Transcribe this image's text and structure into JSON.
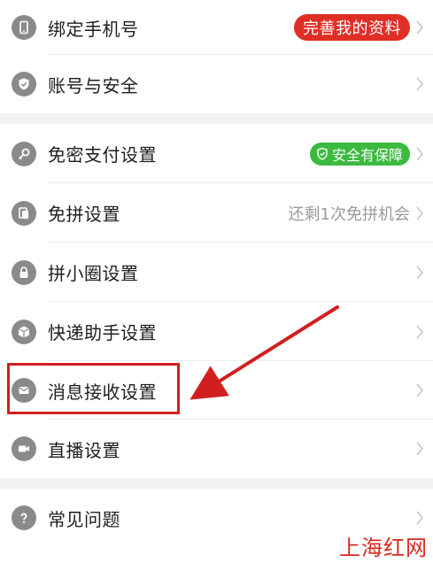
{
  "menu": {
    "bind_phone": {
      "label": "绑定手机号",
      "badge": "完善我的资料"
    },
    "account_security": {
      "label": "账号与安全"
    },
    "password_free_pay": {
      "label": "免密支付设置",
      "badge": "安全有保障"
    },
    "group_free": {
      "label": "免拼设置",
      "note": "还剩1次免拼机会"
    },
    "circle": {
      "label": "拼小圈设置"
    },
    "courier": {
      "label": "快递助手设置"
    },
    "message": {
      "label": "消息接收设置"
    },
    "live": {
      "label": "直播设置"
    },
    "faq": {
      "label": "常见问题"
    }
  },
  "watermark": "上海红网",
  "colors": {
    "accent_red": "#e02e24",
    "badge_green": "#3bba3f",
    "annotation_red": "#d11f1f",
    "icon_gray": "#8a8a8a"
  },
  "icons": {
    "bind_phone": "phone-icon",
    "account_security": "shield-check-icon",
    "password_free_pay": "key-icon",
    "group_free": "coupon-icon",
    "circle": "lock-icon",
    "courier": "package-icon",
    "message": "envelope-icon",
    "live": "video-camera-icon",
    "faq": "question-icon"
  }
}
